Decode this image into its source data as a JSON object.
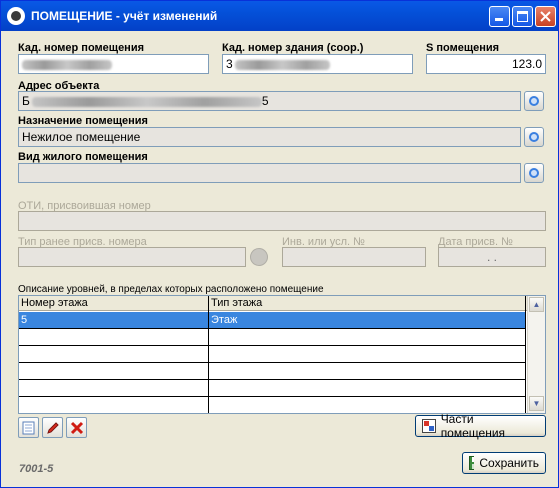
{
  "window": {
    "title": "ПОМЕЩЕНИЕ - учёт изменений"
  },
  "fields": {
    "cad_room_label": "Кад. номер помещения",
    "cad_building_label": "Кад. номер здания (соор.)",
    "cad_building_value_prefix": "3",
    "area_label": "S помещения",
    "area_value": "123.0",
    "address_label": "Адрес объекта",
    "address_value_prefix": "Б",
    "address_value_suffix": "5",
    "purpose_label": "Назначение помещения",
    "purpose_value": "Нежилое помещение",
    "living_type_label": "Вид жилого помещения",
    "oti_label": "ОТИ, присвоившая номер",
    "prev_type_label": "Тип ранее присв. номера",
    "inv_label": "Инв. или усл. №",
    "date_label": "Дата присв. №",
    "date_value": ". ."
  },
  "levels": {
    "caption": "Описание уровней, в пределах которых расположено помещение",
    "columns": [
      "Номер этажа",
      "Тип этажа"
    ],
    "rows": [
      {
        "floor": "5",
        "type": "Этаж"
      }
    ]
  },
  "buttons": {
    "parts": "Части помещения",
    "save": "Сохранить"
  },
  "footer": {
    "code": "7001-5"
  },
  "colors": {
    "titlebar": "#0450d8",
    "selected_row": "#3a86df",
    "panel": "#ece9d8"
  }
}
